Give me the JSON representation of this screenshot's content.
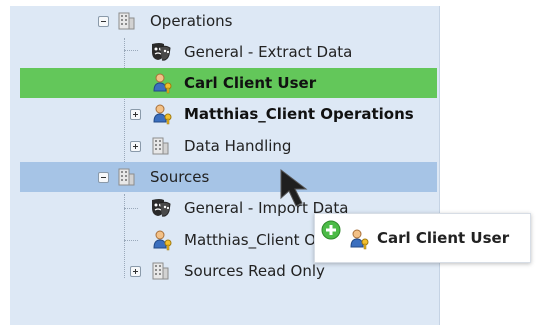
{
  "tree": {
    "operations": {
      "label": "Operations"
    },
    "general_extract": {
      "label": "General - Extract Data"
    },
    "carl_client_user": {
      "label": "Carl Client User"
    },
    "matthias_client_operations": {
      "label": "Matthias_Client Operations"
    },
    "data_handling": {
      "label": "Data Handling"
    },
    "sources": {
      "label": "Sources"
    },
    "general_import": {
      "label": "General - Import Data"
    },
    "matthias_client_ope": {
      "label": "Matthias_Client Ope"
    },
    "sources_read_only": {
      "label": "Sources Read Only"
    }
  },
  "drag_tooltip": {
    "label": "Carl Client User"
  },
  "colors": {
    "panel_bg": "#dde8f5",
    "selected_row": "#63c75a",
    "hover_row": "#a6c4e6",
    "add_badge": "#4cbb47"
  },
  "icons": {
    "folder": "building-icon",
    "mask": "theater-mask-icon",
    "user": "user-key-icon",
    "add": "add-plus-icon",
    "cursor": "arrow-cursor-icon"
  }
}
